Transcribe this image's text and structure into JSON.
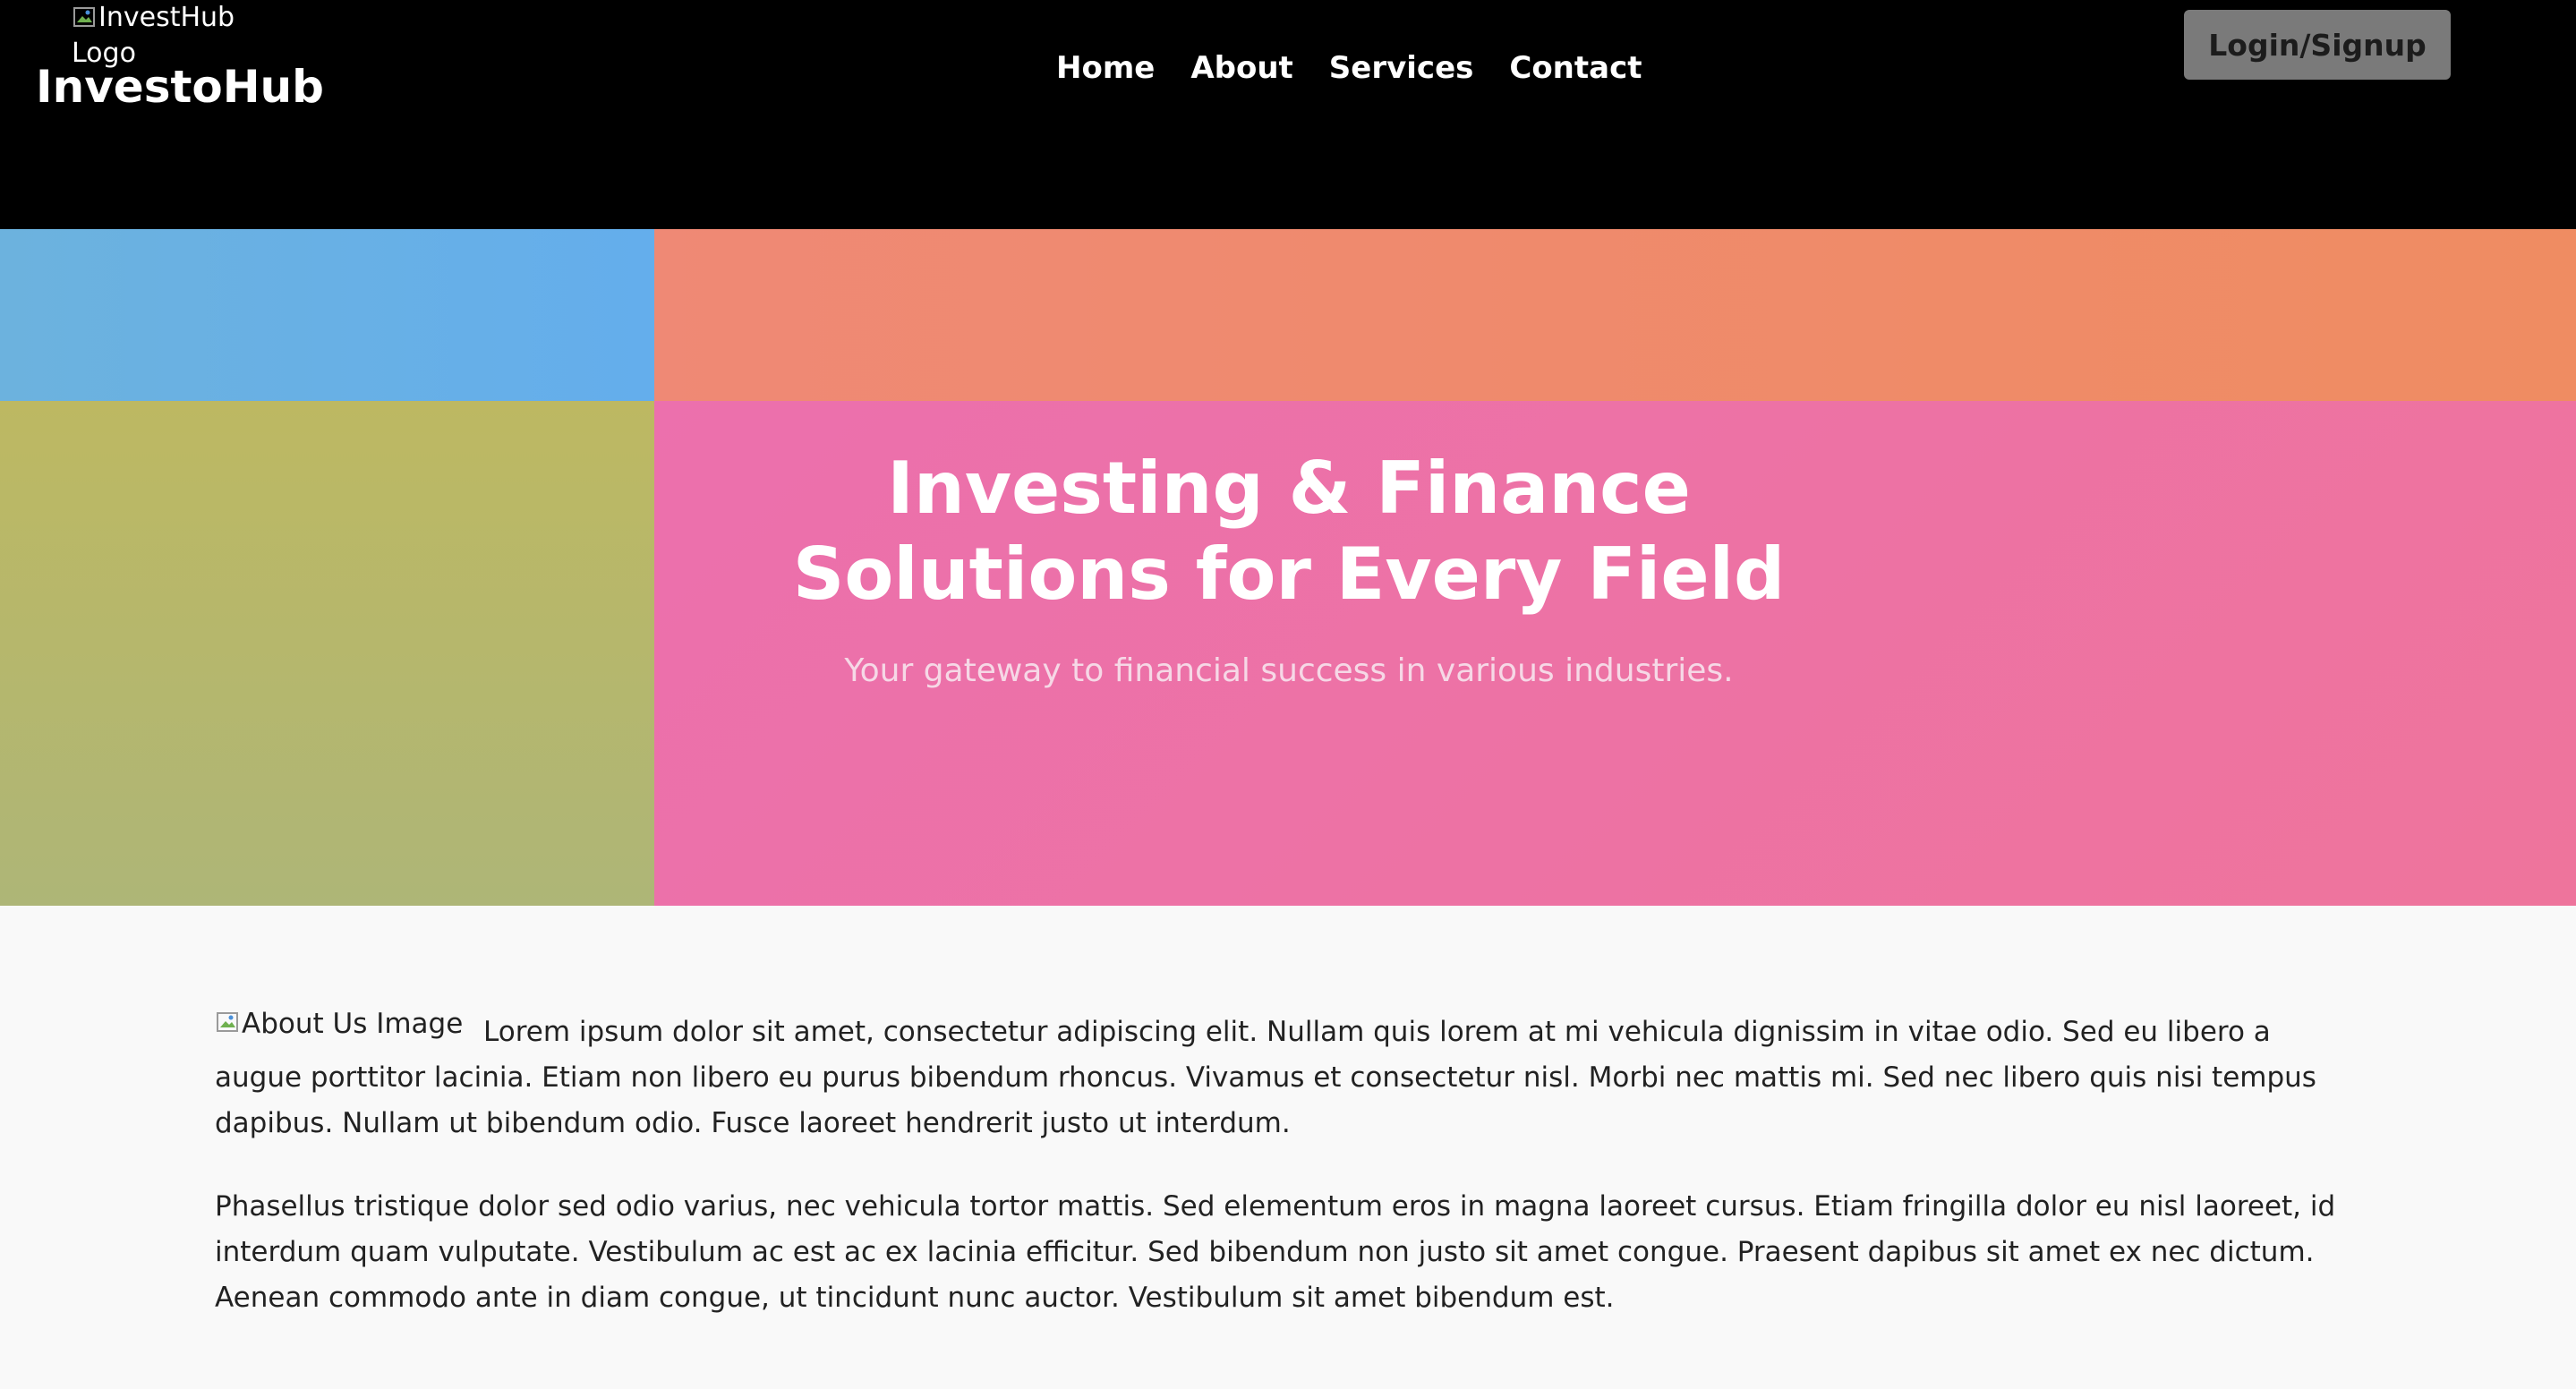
{
  "header": {
    "logo_alt": "InvestHub Logo",
    "brand_name": "InvestoHub",
    "nav": [
      {
        "label": "Home"
      },
      {
        "label": "About"
      },
      {
        "label": "Services"
      },
      {
        "label": "Contact"
      }
    ],
    "login_label": "Login/Signup"
  },
  "hero": {
    "title": "Investing & Finance Solutions for Every Field",
    "subtitle": "Your gateway to financial success in various industries."
  },
  "about": {
    "image_alt": "About Us Image",
    "paragraphs": [
      "Lorem ipsum dolor sit amet, consectetur adipiscing elit. Nullam quis lorem at mi vehicula dignissim in vitae odio. Sed eu libero a augue porttitor lacinia. Etiam non libero eu purus bibendum rhoncus. Vivamus et consectetur nisl. Morbi nec mattis mi. Sed nec libero quis nisi tempus dapibus. Nullam ut bibendum odio. Fusce laoreet hendrerit justo ut interdum.",
      "Phasellus tristique dolor sed odio varius, nec vehicula tortor mattis. Sed elementum eros in magna laoreet cursus. Etiam fringilla dolor eu nisl laoreet, id interdum quam vulputate. Vestibulum ac est ac ex lacinia efficitur. Sed bibendum non justo sit amet congue. Praesent dapibus sit amet ex nec dictum. Aenean commodo ante in diam congue, ut tincidunt nunc auctor. Vestibulum sit amet bibendum est."
    ]
  },
  "colors": {
    "header_bg": "#000000",
    "login_bg": "#7a7a7a",
    "hero_blue": "#64aeec",
    "hero_orange": "#ef8a6a",
    "hero_olive": "#b8b76a",
    "hero_pink": "#ec71a8",
    "page_bg": "#f9f9f9"
  },
  "icons": {
    "logo": "broken-image-icon",
    "about_image": "broken-image-icon"
  }
}
